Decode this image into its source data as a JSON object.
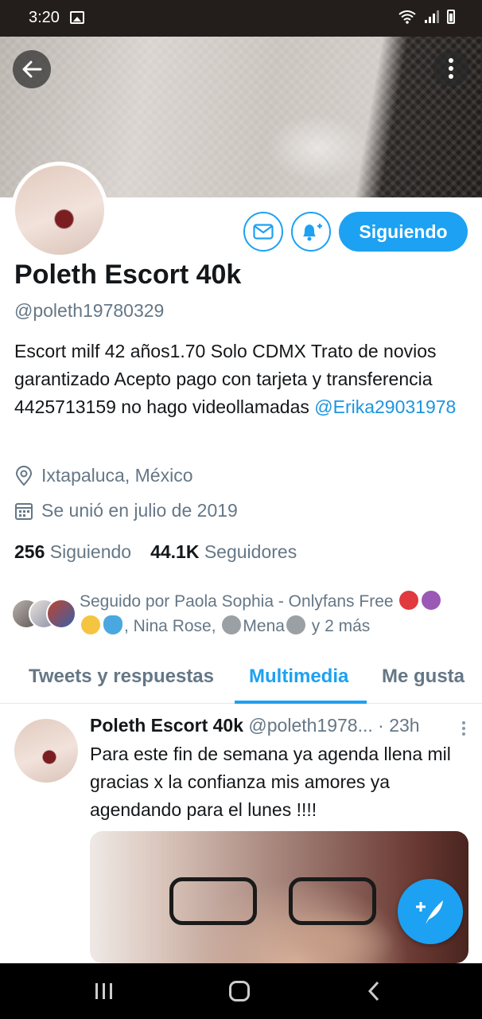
{
  "status_bar": {
    "time": "3:20"
  },
  "profile": {
    "display_name": "Poleth Escort 40k",
    "handle": "@poleth19780329",
    "bio_text": "Escort milf 42 años1.70  Solo CDMX  Trato de novios garantizado Acepto pago con tarjeta y transferencia  4425713159  no hago videollamadas ",
    "bio_link": "@Erika29031978",
    "location": "Ixtapaluca, México",
    "joined": "Se unió en julio de 2019",
    "following_count": "256",
    "following_label": "Siguiendo",
    "followers_count": "44.1K",
    "followers_label": "Seguidores",
    "follow_button": "Siguiendo"
  },
  "followed_by": {
    "line1": "Seguido por Paola Sophia - Onlyfans Free",
    "line2_a": ", Nina Rose,",
    "line2_b": "Mena",
    "line2_c": " y 2 más"
  },
  "tabs": [
    {
      "label": "Tweets y respuestas"
    },
    {
      "label": "Multimedia"
    },
    {
      "label": "Me gusta"
    }
  ],
  "tweet": {
    "name": "Poleth Escort 40k",
    "handle": "@poleth1978...",
    "time": "· 23h",
    "text": "Para este fin de semana ya agenda llena mil gracias x la confianza mis amores ya agendando para el lunes !!!!"
  },
  "colors": {
    "accent": "#1da1f2",
    "secondary_text": "#657786"
  }
}
